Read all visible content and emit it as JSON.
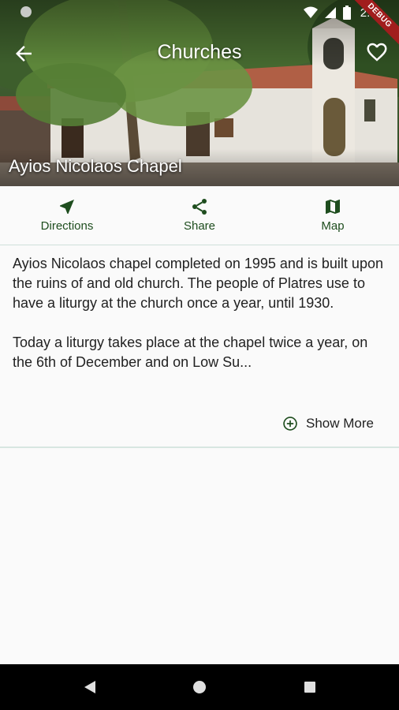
{
  "status_bar": {
    "time": "2:50",
    "debug_label": "DEBUG",
    "icons": [
      "notification-dot-icon",
      "wifi-icon",
      "signal-icon",
      "battery-icon"
    ]
  },
  "app_bar": {
    "title": "Churches",
    "back_icon": "arrow-back-icon",
    "favorite_icon": "heart-outline-icon"
  },
  "hero": {
    "place_name": "Ayios Nicolaos Chapel"
  },
  "actions": [
    {
      "label": "Directions",
      "icon": "navigation-arrow-icon"
    },
    {
      "label": "Share",
      "icon": "share-icon"
    },
    {
      "label": "Map",
      "icon": "map-icon"
    }
  ],
  "description": {
    "paragraph_1": "Ayios Nicolaos chapel completed on 1995 and is built upon the ruins of and old church. The people of Platres use to have a liturgy at the church once a year, until 1930.",
    "paragraph_2": "Today a liturgy takes place at the chapel twice a year, on the 6th of December and on Low Su..."
  },
  "show_more": {
    "label": "Show More",
    "icon": "add-circle-outline-icon"
  },
  "nav": {
    "icons": [
      "back-triangle-icon",
      "home-circle-icon",
      "recents-square-icon"
    ]
  },
  "colors": {
    "accent_green": "#1e4d1e",
    "debug_red": "#a11d1d",
    "background": "#fafafa",
    "nav_bar": "#000000"
  }
}
